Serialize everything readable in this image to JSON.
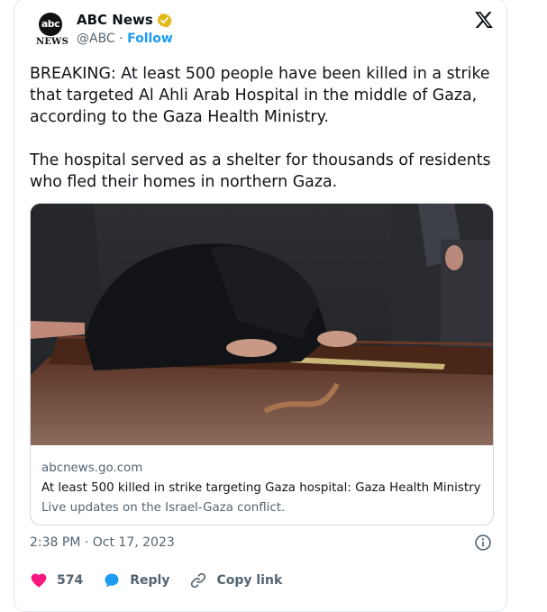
{
  "author": {
    "name": "ABC News",
    "handle": "@ABC",
    "separator": "·",
    "follow_label": "Follow",
    "avatar_logo_text": "abc",
    "avatar_sub_text": "NEWS"
  },
  "tweet": {
    "paragraphs": [
      "BREAKING: At least 500 people have been killed in a strike that targeted Al Ahli Arab Hospital in the middle of Gaza, according to the Gaza Health Ministry.",
      "The hospital served as a shelter for thousands of residents who fled their homes in northern Gaza."
    ]
  },
  "link_card": {
    "domain": "abcnews.go.com",
    "title": "At least 500 killed in strike targeting Gaza hospital: Gaza Health Ministry",
    "description": "Live updates on the Israel-Gaza conflict."
  },
  "meta": {
    "timestamp": "2:38 PM · Oct 17, 2023"
  },
  "actions": {
    "like_count": "574",
    "reply_label": "Reply",
    "copy_link_label": "Copy link"
  },
  "icons": {
    "verified": "verified-badge-icon",
    "x_logo": "x-logo-icon",
    "info": "info-icon",
    "heart": "heart-icon",
    "reply": "reply-bubble-icon",
    "link": "link-icon"
  },
  "colors": {
    "accent_blue": "#1d9bf0",
    "verified_gold": "#e2b719",
    "like_pink": "#f91880",
    "muted_text": "#536471",
    "primary_text": "#0f1419",
    "border": "#cfd9de"
  }
}
